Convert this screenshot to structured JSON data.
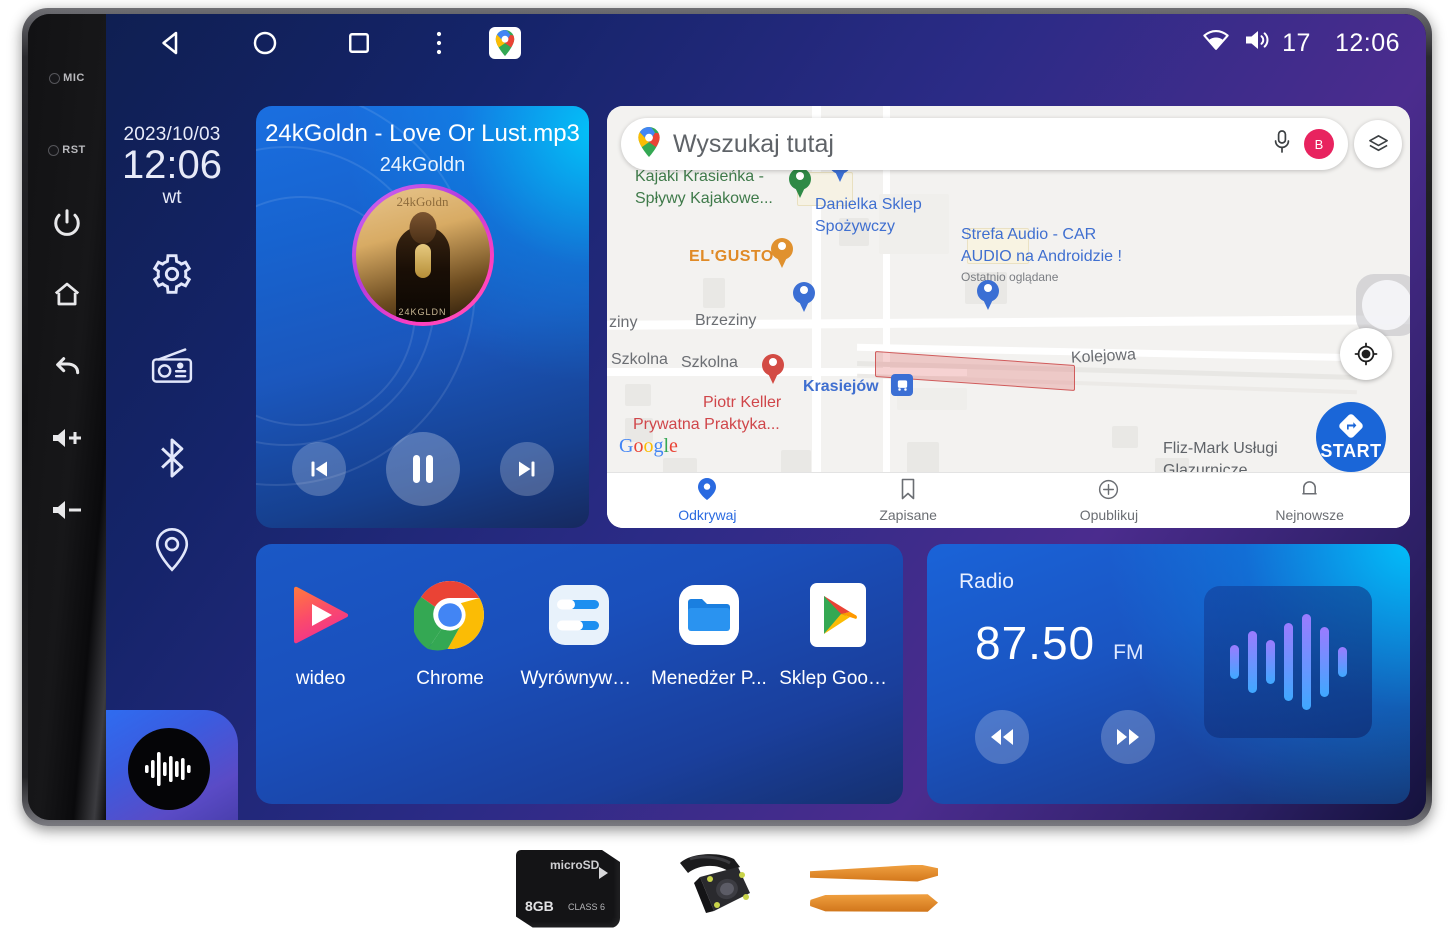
{
  "bezel": {
    "buttons": [
      {
        "name": "mic-indicator",
        "label": "MIC"
      },
      {
        "name": "reset-indicator",
        "label": "RST"
      },
      {
        "name": "power-button",
        "label": ""
      },
      {
        "name": "home-button",
        "label": ""
      },
      {
        "name": "back-button",
        "label": ""
      },
      {
        "name": "volume-up-button",
        "label": ""
      },
      {
        "name": "volume-down-button",
        "label": ""
      }
    ]
  },
  "statusbar": {
    "nav": [
      "back-icon",
      "home-icon",
      "recents-icon",
      "overflow-icon",
      "google-maps-icon"
    ],
    "wifi": "wifi-icon",
    "volume_icon": "volume-icon",
    "volume_value": "17",
    "clock": "12:06"
  },
  "rail": {
    "date": "2023/10/03",
    "time": "12:06",
    "weekday": "wt",
    "icons": [
      "settings-icon",
      "radio-icon",
      "bluetooth-icon",
      "location-icon"
    ],
    "music_tile": "music-waveform-icon"
  },
  "music": {
    "title": "24kGoldn - Love Or Lust.mp3",
    "artist": "24kGoldn",
    "album_top_text": "24kGoldn",
    "album_bottom_text": "24KGLDN",
    "controls": {
      "previous": "previous-track-icon",
      "play_pause": "pause-icon",
      "next": "next-track-icon"
    }
  },
  "map": {
    "search_placeholder": "Wyszukaj tutaj",
    "mic_icon": "microphone-icon",
    "avatar_initial": "B",
    "layers_icon": "layers-icon",
    "locate_icon": "my-location-icon",
    "start_label": "START",
    "google_logo": [
      "G",
      "o",
      "o",
      "g",
      "l",
      "e"
    ],
    "places": [
      {
        "name": "Kajaki Krasieńka -",
        "style": "green"
      },
      {
        "name": "Spływy Kajakowe...",
        "style": "green"
      },
      {
        "name": "Danielka Sklep",
        "style": "blue"
      },
      {
        "name": "Spożywczy",
        "style": "blue"
      },
      {
        "name": "Strefa Audio - CAR",
        "style": "blue"
      },
      {
        "name": "AUDIO na Androidzie !",
        "style": "blue"
      },
      {
        "name": "Ostatnio oglądane",
        "style": "sm"
      },
      {
        "name": "EL'GUSTO",
        "style": "orange"
      },
      {
        "name": "Piotr Keller",
        "style": "red"
      },
      {
        "name": "Prywatna Praktyka...",
        "style": "red"
      },
      {
        "name": "Krasiejów",
        "style": "blue"
      },
      {
        "name": "Fliz-Mark Usługi",
        "style": "grey"
      },
      {
        "name": "Glazurnicze",
        "style": "grey"
      }
    ],
    "streets": [
      "ziny",
      "Brzeziny",
      "Szkolna",
      "Szkolna",
      "Kolejowa"
    ],
    "tabs": [
      {
        "label": "Odkrywaj",
        "icon": "pin-icon",
        "active": true
      },
      {
        "label": "Zapisane",
        "icon": "bookmark-icon",
        "active": false
      },
      {
        "label": "Opublikuj",
        "icon": "plus-circle-icon",
        "active": false
      },
      {
        "label": "Nejnowsze",
        "icon": "bell-icon",
        "active": false
      }
    ]
  },
  "apps": [
    {
      "label": "wideo",
      "icon": "video-player-icon"
    },
    {
      "label": "Chrome",
      "icon": "chrome-icon"
    },
    {
      "label": "Wyrównywa...",
      "icon": "equalizer-icon"
    },
    {
      "label": "Menedżer P...",
      "icon": "file-manager-icon"
    },
    {
      "label": "Sklep Googl...",
      "icon": "google-play-icon"
    }
  ],
  "radio": {
    "label": "Radio",
    "frequency": "87.50",
    "band": "FM",
    "prev_icon": "rewind-icon",
    "next_icon": "fast-forward-icon",
    "wave_icon": "audio-wave-icon",
    "wave_heights": [
      34,
      62,
      44,
      78,
      96,
      70,
      30
    ]
  },
  "accessories": [
    {
      "name": "microsd-card",
      "line1": "microSD",
      "capacity": "8GB",
      "class": "CLASS 6"
    },
    {
      "name": "reversing-camera",
      "label": ""
    },
    {
      "name": "pry-tools",
      "label": ""
    }
  ],
  "colors": {
    "accent_blue": "#1a66d8",
    "card_blue": "#1a58c6",
    "map_bg": "#f3f2f0",
    "tab_active": "#2a6ae0",
    "avatar": "#e8235f"
  }
}
